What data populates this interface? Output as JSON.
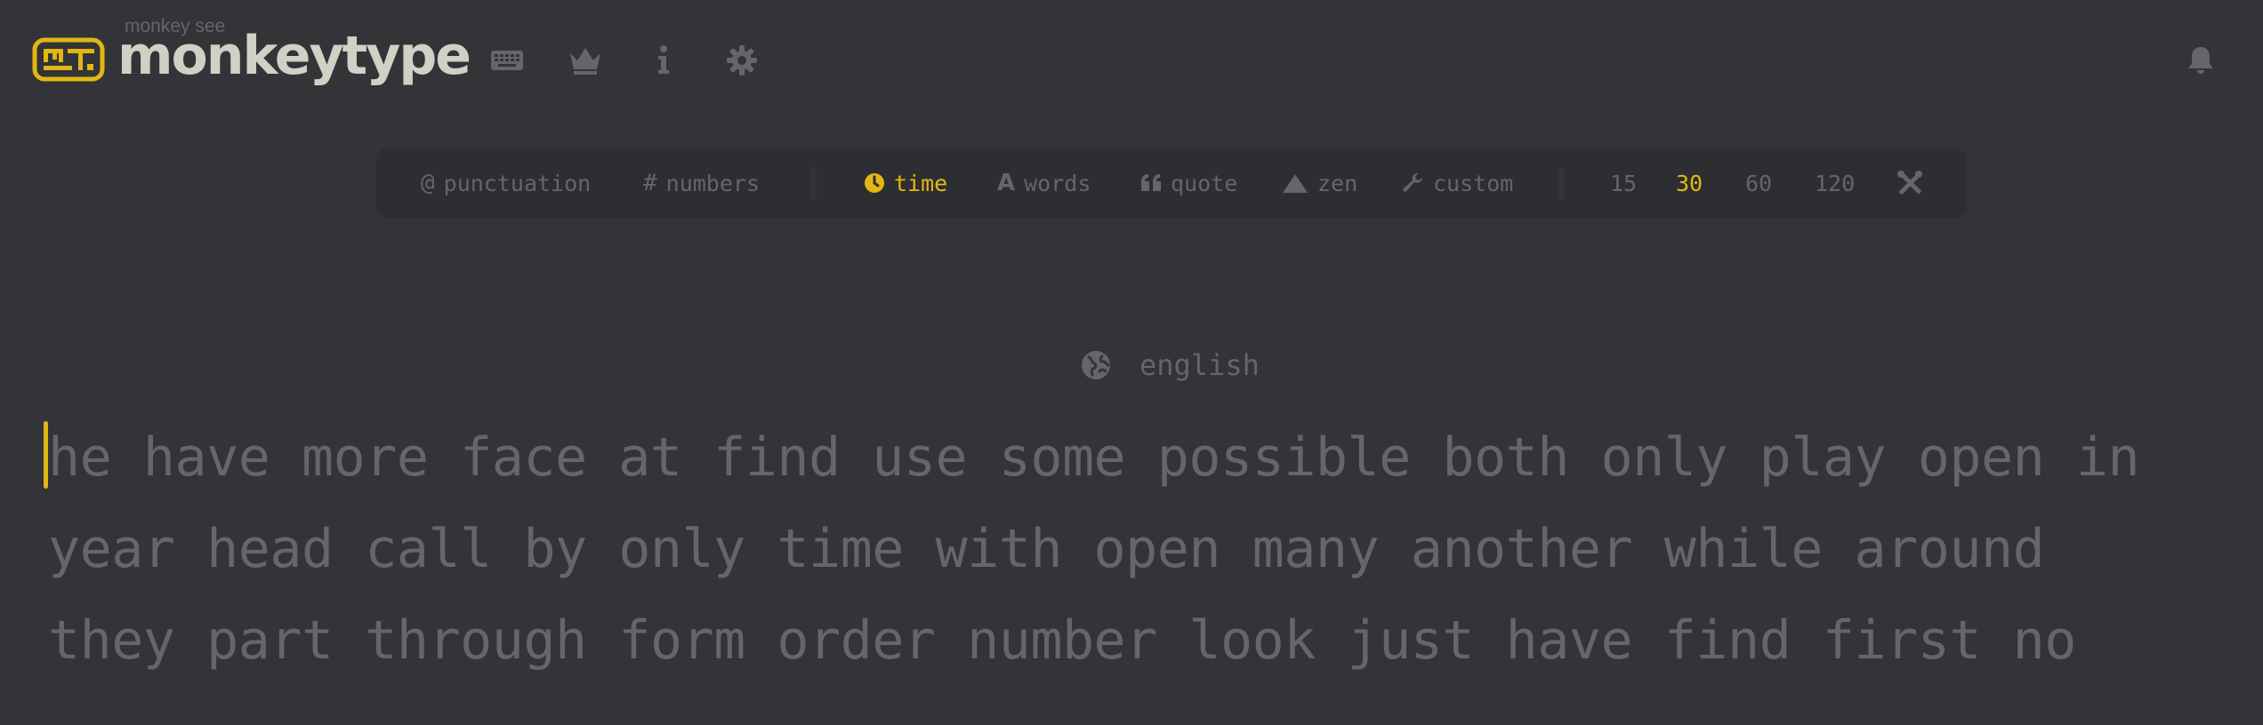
{
  "header": {
    "logo_subtitle": "monkey see",
    "logo_title": "monkeytype",
    "logo_badge": "MT",
    "nav_icons": [
      "keyboard-icon",
      "crown-icon",
      "info-icon",
      "settings-icon"
    ],
    "notification_icon": "bell-icon"
  },
  "config": {
    "punctuation": "punctuation",
    "numbers": "numbers",
    "time": "time",
    "words": "words",
    "quote": "quote",
    "zen": "zen",
    "custom": "custom",
    "time_options": [
      "15",
      "30",
      "60",
      "120"
    ],
    "active_mode": "time",
    "active_duration": "30"
  },
  "language": "english",
  "words_lines": [
    "he have more face at find use some possible both only play open in",
    "year head call by only time with open many another while around",
    "they part through form order number look just have find first no"
  ],
  "colors": {
    "background": "#323437",
    "sub_background": "#2c2e31",
    "accent": "#e2b714",
    "sub_text": "#646669",
    "main_text": "#d1d0c5"
  }
}
